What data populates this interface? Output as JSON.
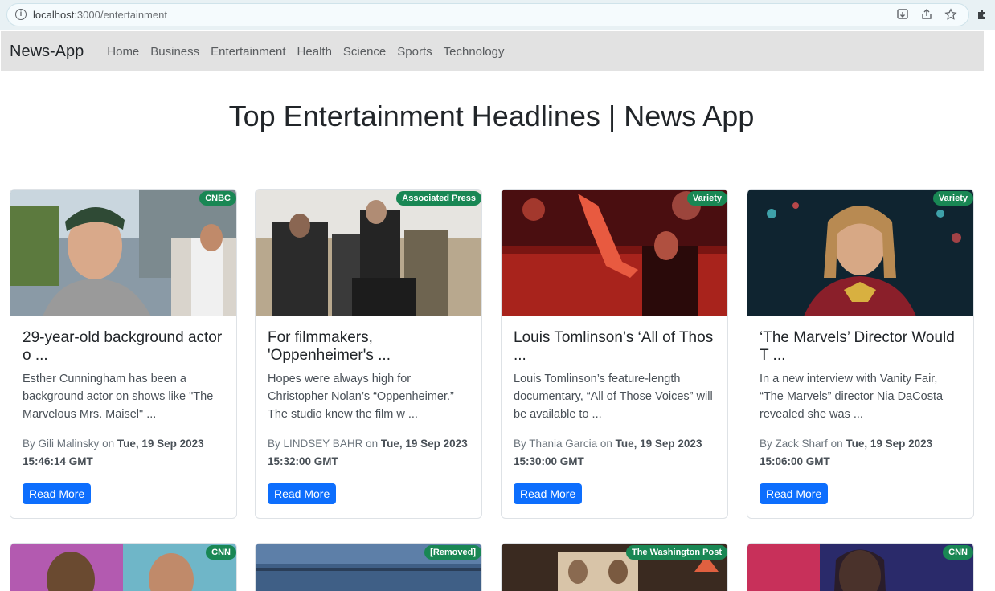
{
  "browser": {
    "url_host": "localhost",
    "url_path": ":3000/entertainment"
  },
  "navbar": {
    "brand": "News-App",
    "links": [
      "Home",
      "Business",
      "Entertainment",
      "Health",
      "Science",
      "Sports",
      "Technology"
    ]
  },
  "page_title": "Top Entertainment Headlines | News App",
  "cards": [
    {
      "source": "CNBC",
      "title": "29-year-old background actor o ...",
      "description": "Esther Cunningham has been a background actor on shows like \"The Marvelous Mrs. Maisel\" ...",
      "by_label": "By",
      "author": "Gili Malinsky",
      "on_label": "on",
      "date": "Tue, 19 Sep 2023 15:46:14 GMT",
      "button": "Read More"
    },
    {
      "source": "Associated Press",
      "title": "For filmmakers, 'Oppenheimer's ...",
      "description": "Hopes were always high for Christopher Nolan’s “Oppenheimer.” The studio knew the film w ...",
      "by_label": "By",
      "author": "LINDSEY BAHR",
      "on_label": "on",
      "date": "Tue, 19 Sep 2023 15:32:00 GMT",
      "button": "Read More"
    },
    {
      "source": "Variety",
      "title": "Louis Tomlinson’s ‘All of Thos ...",
      "description": "Louis Tomlinson’s feature-length documentary, “All of Those Voices” will be available to ...",
      "by_label": "By",
      "author": "Thania Garcia",
      "on_label": "on",
      "date": "Tue, 19 Sep 2023 15:30:00 GMT",
      "button": "Read More"
    },
    {
      "source": "Variety",
      "title": "‘The Marvels’ Director Would T ...",
      "description": "In a new interview with Vanity Fair, “The Marvels” director Nia DaCosta revealed she was ...",
      "by_label": "By",
      "author": "Zack Sharf",
      "on_label": "on",
      "date": "Tue, 19 Sep 2023 15:06:00 GMT",
      "button": "Read More"
    }
  ],
  "next_row_sources": [
    "CNN",
    "[Removed]",
    "The Washington Post",
    "CNN"
  ],
  "colors": {
    "badge": "#198754",
    "button": "#0d6efd",
    "navbar": "#e2e2e2"
  }
}
